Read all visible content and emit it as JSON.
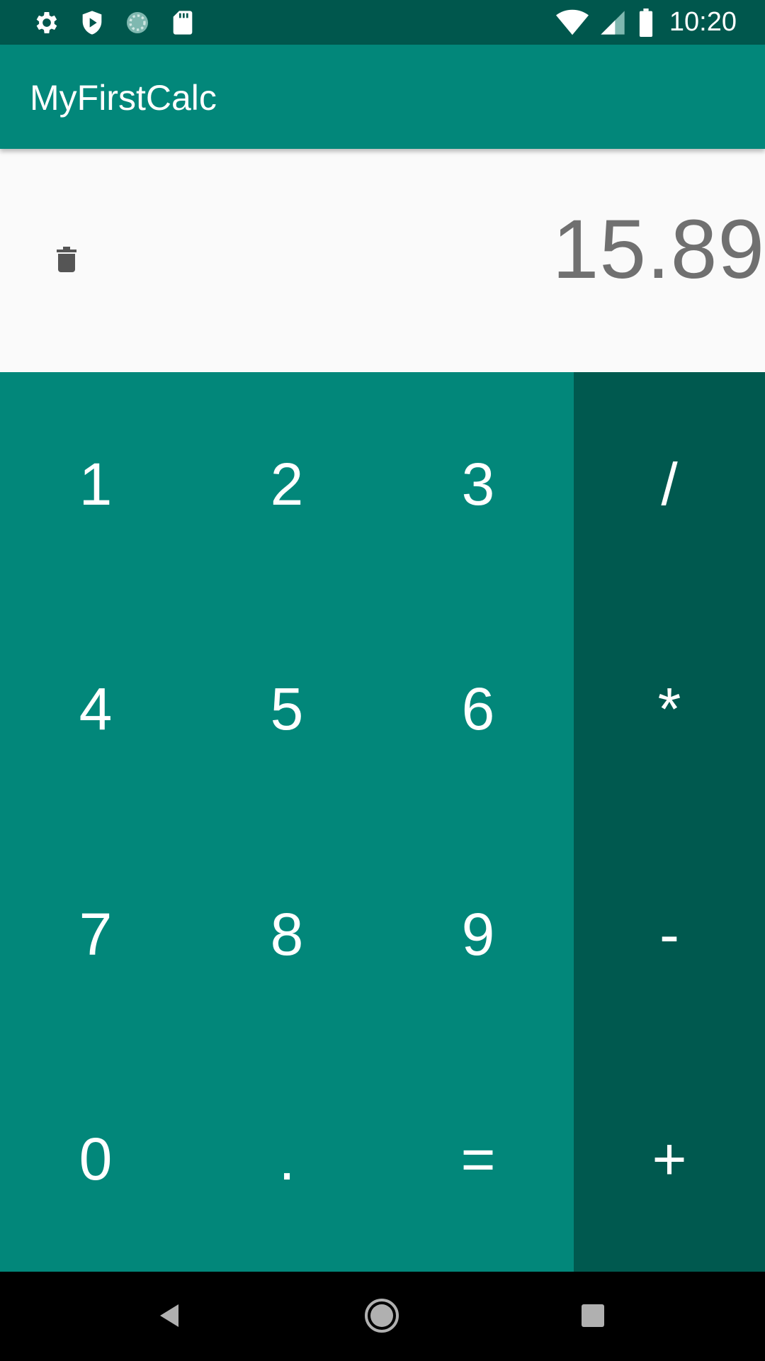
{
  "status_bar": {
    "time": "10:20",
    "left_icons": [
      "settings-icon",
      "shield-play-icon",
      "sync-icon",
      "sd-card-icon"
    ],
    "right_icons": [
      "wifi-icon",
      "signal-icon",
      "battery-icon"
    ]
  },
  "app_bar": {
    "title": "MyFirstCalc"
  },
  "display": {
    "value": "15.89",
    "delete_icon": "trash-icon"
  },
  "keypad": {
    "digits": [
      "1",
      "2",
      "3",
      "4",
      "5",
      "6",
      "7",
      "8",
      "9",
      "0",
      ".",
      "="
    ],
    "operators": [
      "/",
      "*",
      "-",
      "+"
    ]
  },
  "nav_bar": {
    "icons": [
      "back-icon",
      "home-icon",
      "recents-icon"
    ]
  },
  "colors": {
    "status_bar": "#00574d",
    "app_bar": "#02877a",
    "keypad": "#02877a",
    "operators": "#00594f",
    "display_bg": "#fafafa",
    "display_text": "#707070"
  }
}
